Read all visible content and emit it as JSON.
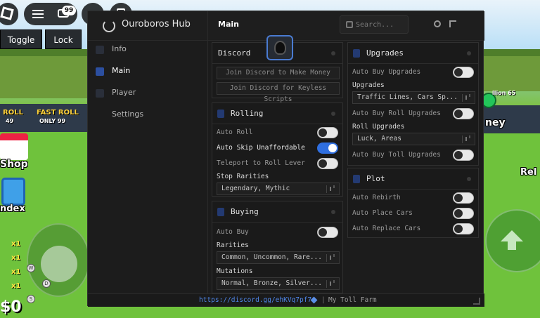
{
  "game": {
    "roll_label": "ROLL",
    "roll_price": "49",
    "fast_roll_label": "FAST ROLL",
    "fast_roll_price": "ONLY 99",
    "shop_label": "Shop",
    "index_label": "ndex",
    "money": "$0",
    "right_label": "ney",
    "rebirth_label": "Rel",
    "multipliers": [
      "x1",
      "x1",
      "x1",
      "x1"
    ],
    "sign_text": "llion 65"
  },
  "topbar": {
    "chat_badge": "99",
    "toggle_label": "Toggle",
    "lock_label": "Lock"
  },
  "hub": {
    "title": "Ouroboros Hub",
    "page_title": "Main",
    "search_placeholder": "Search...",
    "nav": [
      {
        "label": "Info"
      },
      {
        "label": "Main"
      },
      {
        "label": "Player"
      },
      {
        "label": "Settings"
      }
    ],
    "discord": {
      "title": "Discord",
      "buttons": [
        "Join Discord to Make Money",
        "Join Discord for Keyless Scripts"
      ]
    },
    "rolling": {
      "title": "Rolling",
      "auto_roll": "Auto Roll",
      "auto_skip": "Auto Skip Unaffordable",
      "teleport": "Teleport to Roll Lever",
      "stop_rarities_label": "Stop Rarities",
      "stop_rarities_value": "Legendary, Mythic"
    },
    "buying": {
      "title": "Buying",
      "auto_buy": "Auto Buy",
      "rarities_label": "Rarities",
      "rarities_value": "Common, Uncommon, Rare...",
      "mutations_label": "Mutations",
      "mutations_value": "Normal, Bronze, Silver..."
    },
    "upgrades": {
      "title": "Upgrades",
      "auto_buy_upgrades": "Auto Buy Upgrades",
      "upgrades_label": "Upgrades",
      "upgrades_value": "Traffic Lines, Cars Sp...",
      "auto_buy_roll_upgrades": "Auto Buy Roll Upgrades",
      "roll_upgrades_label": "Roll Upgrades",
      "roll_upgrades_value": "Luck, Areas",
      "auto_buy_toll_upgrades": "Auto Buy Toll Upgrades"
    },
    "plot": {
      "title": "Plot",
      "auto_rebirth": "Auto Rebirth",
      "auto_place_cars": "Auto Place Cars",
      "auto_replace_cars": "Auto Replace Cars"
    },
    "toggles": {
      "auto_roll": false,
      "auto_skip": true,
      "teleport": false,
      "auto_buy": false,
      "auto_buy_upgrades": false,
      "auto_buy_roll_upgrades": false,
      "auto_buy_toll_upgrades": false,
      "auto_rebirth": false,
      "auto_place_cars": false,
      "auto_replace_cars": false
    },
    "footer": {
      "link": "https://discord.gg/ehKVq7pf7v",
      "separator": "|",
      "text": "My Toll Farm"
    }
  },
  "colors": {
    "accent": "#2f6fe0",
    "link": "#4f86e8",
    "panel": "#1c1c1c"
  }
}
